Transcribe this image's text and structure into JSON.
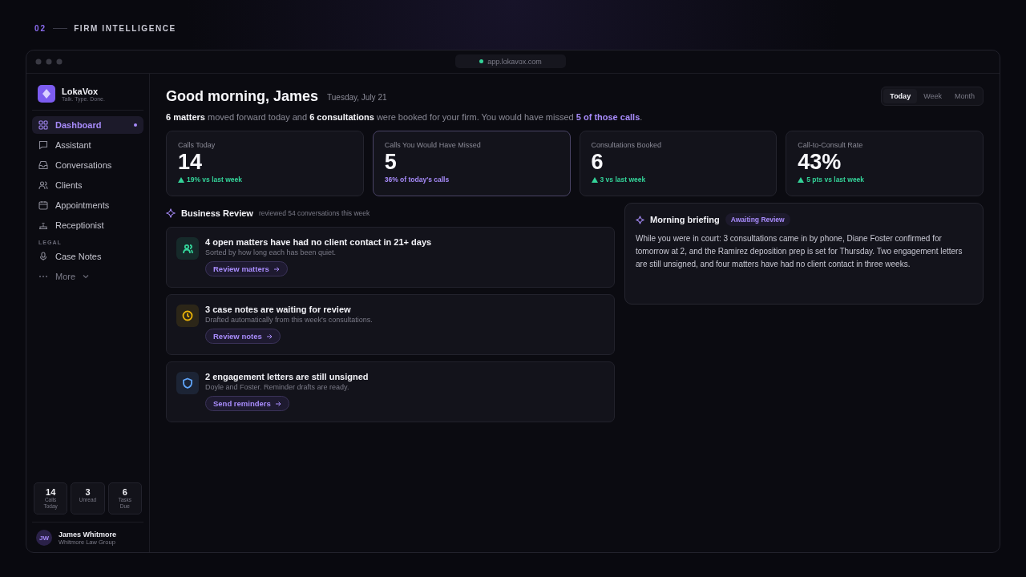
{
  "header": {
    "number": "02",
    "title": "FIRM INTELLIGENCE"
  },
  "window": {
    "url": "app.lokavox.com"
  },
  "sidebar": {
    "brand": {
      "name": "LokaVox",
      "tagline": "Talk. Type. Done."
    },
    "items": [
      {
        "label": "Dashboard",
        "selected": true
      },
      {
        "label": "Assistant",
        "selected": false
      },
      {
        "label": "Conversations",
        "selected": false
      },
      {
        "label": "Clients",
        "selected": false
      },
      {
        "label": "Appointments",
        "selected": false
      },
      {
        "label": "Receptionist",
        "selected": false
      }
    ],
    "section": {
      "label": "LEGAL",
      "items": [
        {
          "label": "Case Notes",
          "selected": false
        }
      ]
    },
    "more": {
      "label": "More"
    },
    "stats": [
      {
        "value": "14",
        "label": "Calls Today"
      },
      {
        "value": "3",
        "label": "Unread"
      },
      {
        "value": "6",
        "label": "Tasks Due"
      }
    ],
    "user": {
      "initials": "JW",
      "name": "James Whitmore",
      "org": "Whitmore Law Group"
    }
  },
  "main": {
    "greeting": "Good morning, James",
    "date": "Tuesday, July 21",
    "ranges": [
      {
        "label": "Today",
        "selected": true
      },
      {
        "label": "Week",
        "selected": false
      },
      {
        "label": "Month",
        "selected": false
      }
    ],
    "summary": "**6 matters** moved forward today and **6 consultations** were booked for your firm. You would have missed **5 of those calls**.",
    "kpis": [
      {
        "label": "Calls Today",
        "value": "14",
        "delta": "19% vs last week",
        "kind": "up",
        "selected": false
      },
      {
        "label": "Calls You Would Have Missed",
        "value": "5",
        "delta": "36% of today's calls",
        "kind": "note",
        "selected": true
      },
      {
        "label": "Consultations Booked",
        "value": "6",
        "delta": "3 vs last week",
        "kind": "up",
        "selected": false
      },
      {
        "label": "Call-to-Consult Rate",
        "value": "43%",
        "delta": "5 pts vs last week",
        "kind": "up",
        "selected": false
      }
    ],
    "review": {
      "title": "Business Review",
      "subtitle": "reviewed 54 conversations this week",
      "items": [
        {
          "title": "4 open matters have had no client contact in 21+ days",
          "detail": "Sorted by how long each has been quiet.",
          "action": "Review matters",
          "color": "#34d399"
        },
        {
          "title": "3 case notes are waiting for review",
          "detail": "Drafted automatically from this week's consultations.",
          "action": "Review notes",
          "color": "#eab308"
        },
        {
          "title": "2 engagement letters are still unsigned",
          "detail": "Doyle and Foster. Reminder drafts are ready.",
          "action": "Send reminders",
          "color": "#60a5fa"
        }
      ]
    },
    "briefing": {
      "title": "Morning briefing",
      "badge": "Awaiting Review",
      "text": "While you were in court: 3 consultations came in by phone, Diane Foster confirmed for tomorrow at 2, and the Ramirez deposition prep is set for Thursday. Two engagement letters are still unsigned, and four matters have had no client contact in three weeks."
    }
  }
}
